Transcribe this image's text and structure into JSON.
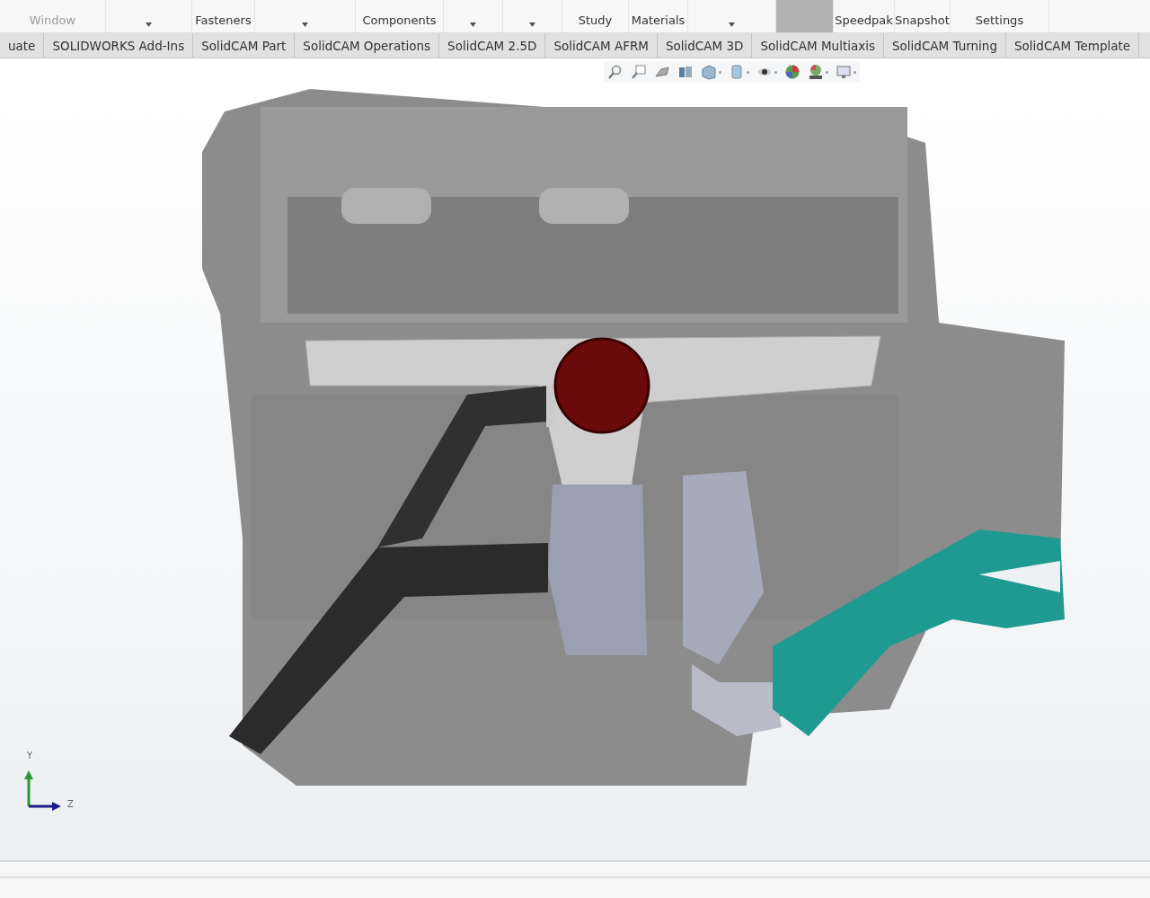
{
  "ribbon": [
    {
      "label": "Window",
      "disabled": true,
      "caret": false,
      "selected": false
    },
    {
      "caret": true,
      "disabled": false,
      "selected": false
    },
    {
      "label": "Fasteners",
      "disabled": false,
      "caret": false,
      "selected": false
    },
    {
      "caret": true,
      "disabled": false,
      "selected": false
    },
    {
      "label": "Components",
      "disabled": false,
      "caret": false,
      "selected": false
    },
    {
      "caret": true,
      "disabled": false,
      "selected": false
    },
    {
      "caret": true,
      "disabled": false,
      "selected": false
    },
    {
      "label": "Study",
      "disabled": false,
      "caret": false,
      "selected": false
    },
    {
      "label": "Materials",
      "disabled": false,
      "caret": false,
      "selected": false
    },
    {
      "caret": true,
      "disabled": false,
      "selected": false
    },
    {
      "disabled": false,
      "caret": false,
      "selected": true
    },
    {
      "label": "Speedpak",
      "disabled": false,
      "caret": false,
      "selected": false
    },
    {
      "label": "Snapshot",
      "disabled": false,
      "caret": false,
      "selected": false
    },
    {
      "label": "Settings",
      "disabled": false,
      "caret": false,
      "selected": false
    }
  ],
  "tabs": [
    {
      "label": "uate",
      "selected": false
    },
    {
      "label": "SOLIDWORKS Add-Ins",
      "selected": false
    },
    {
      "label": "SolidCAM Part",
      "selected": false
    },
    {
      "label": "SolidCAM Operations",
      "selected": false
    },
    {
      "label": "SolidCAM 2.5D",
      "selected": false
    },
    {
      "label": "SolidCAM AFRM",
      "selected": false
    },
    {
      "label": "SolidCAM 3D",
      "selected": false
    },
    {
      "label": "SolidCAM Multiaxis",
      "selected": false
    },
    {
      "label": "SolidCAM Turning",
      "selected": false
    },
    {
      "label": "SolidCAM Template",
      "selected": false
    }
  ],
  "view_toolbar": [
    {
      "kind": "zoom-fit",
      "caret": false
    },
    {
      "kind": "zoom-area",
      "caret": false
    },
    {
      "kind": "previous-view",
      "caret": false
    },
    {
      "kind": "section-view",
      "caret": false
    },
    {
      "kind": "view-orientation",
      "caret": true
    },
    {
      "kind": "display-style",
      "caret": true
    },
    {
      "kind": "hide-show",
      "caret": true
    },
    {
      "kind": "appearance",
      "caret": false
    },
    {
      "kind": "scene",
      "caret": true
    },
    {
      "kind": "display",
      "caret": true
    }
  ],
  "triad": {
    "y_label": "Y",
    "z_label": "Z"
  }
}
